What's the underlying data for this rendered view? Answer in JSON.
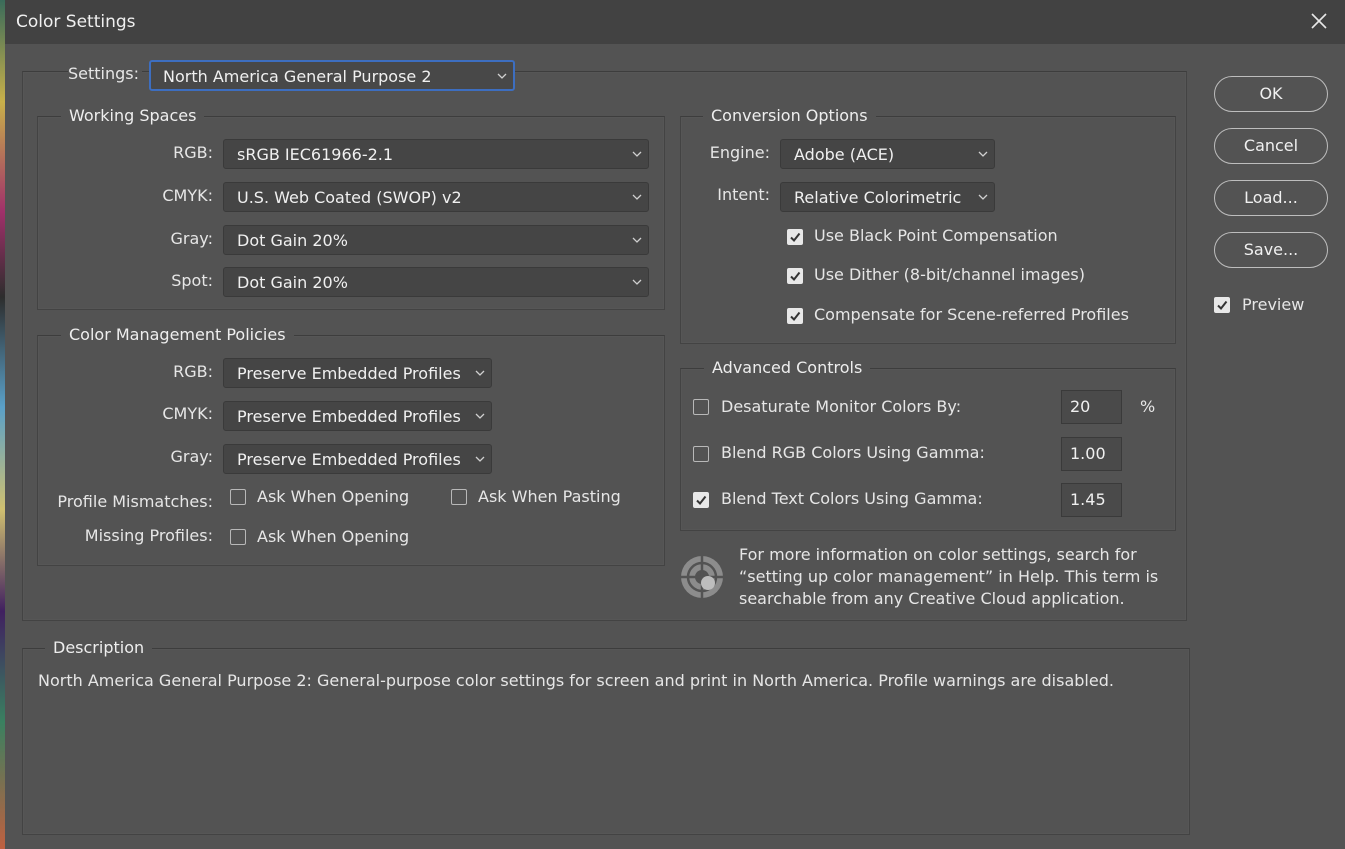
{
  "window": {
    "title": "Color Settings"
  },
  "settings": {
    "label": "Settings:",
    "value": "North America General Purpose 2"
  },
  "working_spaces": {
    "title": "Working Spaces",
    "rows": [
      {
        "label": "RGB:",
        "value": "sRGB IEC61966-2.1"
      },
      {
        "label": "CMYK:",
        "value": "U.S. Web Coated (SWOP) v2"
      },
      {
        "label": "Gray:",
        "value": "Dot Gain 20%"
      },
      {
        "label": "Spot:",
        "value": "Dot Gain 20%"
      }
    ]
  },
  "policies": {
    "title": "Color Management Policies",
    "rows": [
      {
        "label": "RGB:",
        "value": "Preserve Embedded Profiles"
      },
      {
        "label": "CMYK:",
        "value": "Preserve Embedded Profiles"
      },
      {
        "label": "Gray:",
        "value": "Preserve Embedded Profiles"
      }
    ],
    "mismatch_label": "Profile Mismatches:",
    "mismatch_opening": {
      "label": "Ask When Opening",
      "checked": false
    },
    "mismatch_pasting": {
      "label": "Ask When Pasting",
      "checked": false
    },
    "missing_label": "Missing Profiles:",
    "missing_opening": {
      "label": "Ask When Opening",
      "checked": false
    }
  },
  "conversion": {
    "title": "Conversion Options",
    "engine_label": "Engine:",
    "engine_value": "Adobe (ACE)",
    "intent_label": "Intent:",
    "intent_value": "Relative Colorimetric",
    "checks": [
      {
        "label": "Use Black Point Compensation",
        "checked": true
      },
      {
        "label": "Use Dither (8-bit/channel images)",
        "checked": true
      },
      {
        "label": "Compensate for Scene-referred Profiles",
        "checked": true
      }
    ]
  },
  "advanced": {
    "title": "Advanced Controls",
    "desaturate": {
      "label": "Desaturate Monitor Colors By:",
      "checked": false,
      "value": "20",
      "unit": "%"
    },
    "blend_rgb": {
      "label": "Blend RGB Colors Using Gamma:",
      "checked": false,
      "value": "1.00"
    },
    "blend_text": {
      "label": "Blend Text Colors Using Gamma:",
      "checked": true,
      "value": "1.45"
    }
  },
  "info": {
    "icon": "color-wheel-icon",
    "text": "For more information on color settings, search for “setting up color management” in Help. This term is searchable from any Creative Cloud application."
  },
  "buttons": {
    "ok": "OK",
    "cancel": "Cancel",
    "load": "Load...",
    "save": "Save..."
  },
  "preview": {
    "label": "Preview",
    "checked": true
  },
  "description": {
    "title": "Description",
    "text": "North America General Purpose 2:  General-purpose color settings for screen and print in North America. Profile warnings are disabled."
  },
  "colors": {
    "background": "#535353",
    "titlebar": "#424242",
    "focus": "#3d6ec0"
  }
}
